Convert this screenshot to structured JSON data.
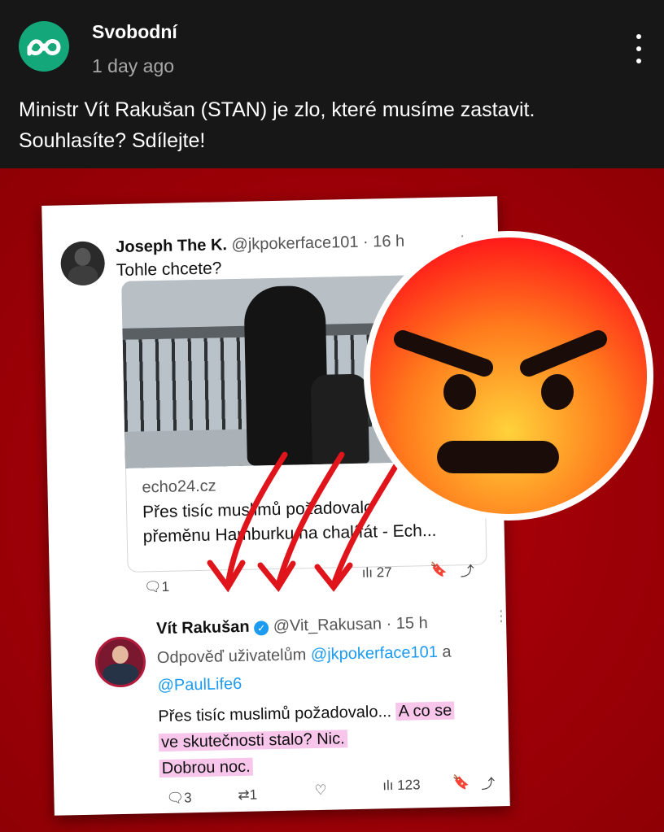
{
  "post": {
    "author": "Svobodní",
    "time": "1 day ago",
    "text": "Ministr Vít Rakušan (STAN) je zlo, které musíme zastavit. Souhlasíte? Sdílejte!"
  },
  "tweet1": {
    "name": "Joseph The K.",
    "handle": "@jkpokerface101 · 16 h",
    "text": "Tohle chcete?",
    "link_domain": "echo24.cz",
    "link_title_1": "Přes tisíc muslimů požadovalo",
    "link_title_2": "přeměnu Hamburku na chalífát - Ech...",
    "replies": "1",
    "views": "27"
  },
  "tweet2": {
    "name": "Vít Rakušan",
    "handle": "@Vit_Rakusan · 15 h",
    "reply_prefix": "Odpověď uživatelům",
    "reply_user1": "@jkpokerface101",
    "reply_and": "a",
    "reply_user2": "@PaulLife6",
    "text_1": "Přes tisíc muslimů požadovalo...",
    "text_hl_1": "A co se",
    "text_hl_2": "ve skutečnosti stalo? Nic.",
    "text_hl_3": "Dobrou noc.",
    "replies": "3",
    "retweets": "1",
    "views": "123"
  },
  "colors": {
    "brand": "#14a779",
    "background": "#a70008",
    "link": "#1d9bf0",
    "highlight": "#f7c6ea"
  }
}
